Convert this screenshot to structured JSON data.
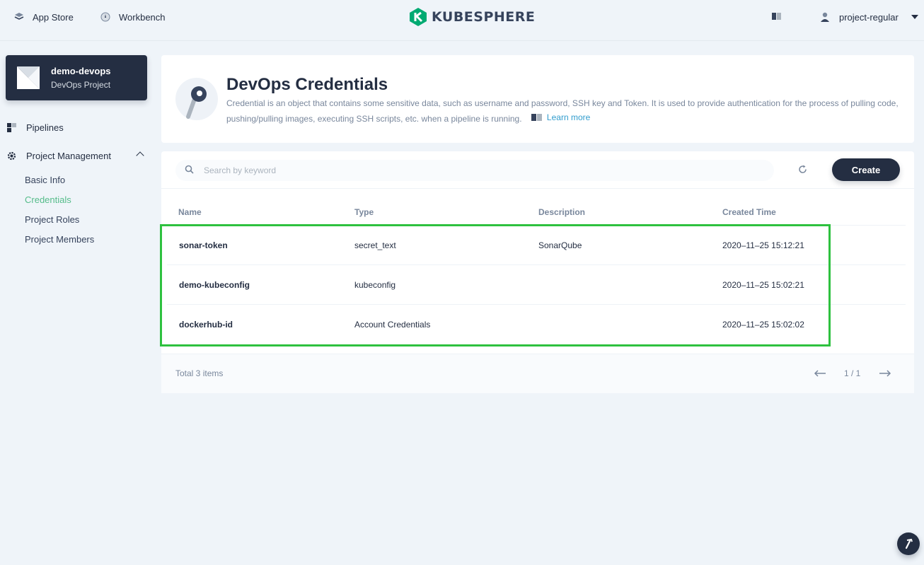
{
  "header": {
    "app_store": "App Store",
    "workbench": "Workbench",
    "logo_text": "KUBESPHERE",
    "user": "project-regular",
    "icons": [
      "app-store-icon",
      "workbench-icon",
      "docs-icon",
      "user-icon",
      "chevron-down-icon"
    ]
  },
  "project": {
    "name": "demo-devops",
    "type": "DevOps Project"
  },
  "sidebar": {
    "pipelines": "Pipelines",
    "project_management": "Project Management",
    "items": [
      {
        "label": "Basic Info",
        "active": false
      },
      {
        "label": "Credentials",
        "active": true
      },
      {
        "label": "Project Roles",
        "active": false
      },
      {
        "label": "Project Members",
        "active": false
      }
    ]
  },
  "banner": {
    "title": "DevOps Credentials",
    "description": "Credential is an object that contains some sensitive data, such as username and password, SSH key and Token. It is used to provide authentication for the process of pulling code, pushing/pulling images, executing SSH scripts, etc. when a pipeline is running.",
    "learn_more": "Learn more"
  },
  "toolbar": {
    "search_placeholder": "Search by keyword",
    "create_label": "Create"
  },
  "table": {
    "columns": [
      "Name",
      "Type",
      "Description",
      "Created Time"
    ],
    "rows": [
      {
        "name": "sonar-token",
        "type": "secret_text",
        "description": "SonarQube",
        "created": "2020–11–25 15:12:21"
      },
      {
        "name": "demo-kubeconfig",
        "type": "kubeconfig",
        "description": "",
        "created": "2020–11–25 15:02:21"
      },
      {
        "name": "dockerhub-id",
        "type": "Account Credentials",
        "description": "",
        "created": "2020–11–25 15:02:02"
      }
    ]
  },
  "footer": {
    "total": "Total 3 items",
    "page": "1 / 1"
  },
  "colors": {
    "accent": "#55bc8a",
    "link": "#329dce",
    "dark": "#242e42",
    "highlight": "#2ec13f"
  }
}
